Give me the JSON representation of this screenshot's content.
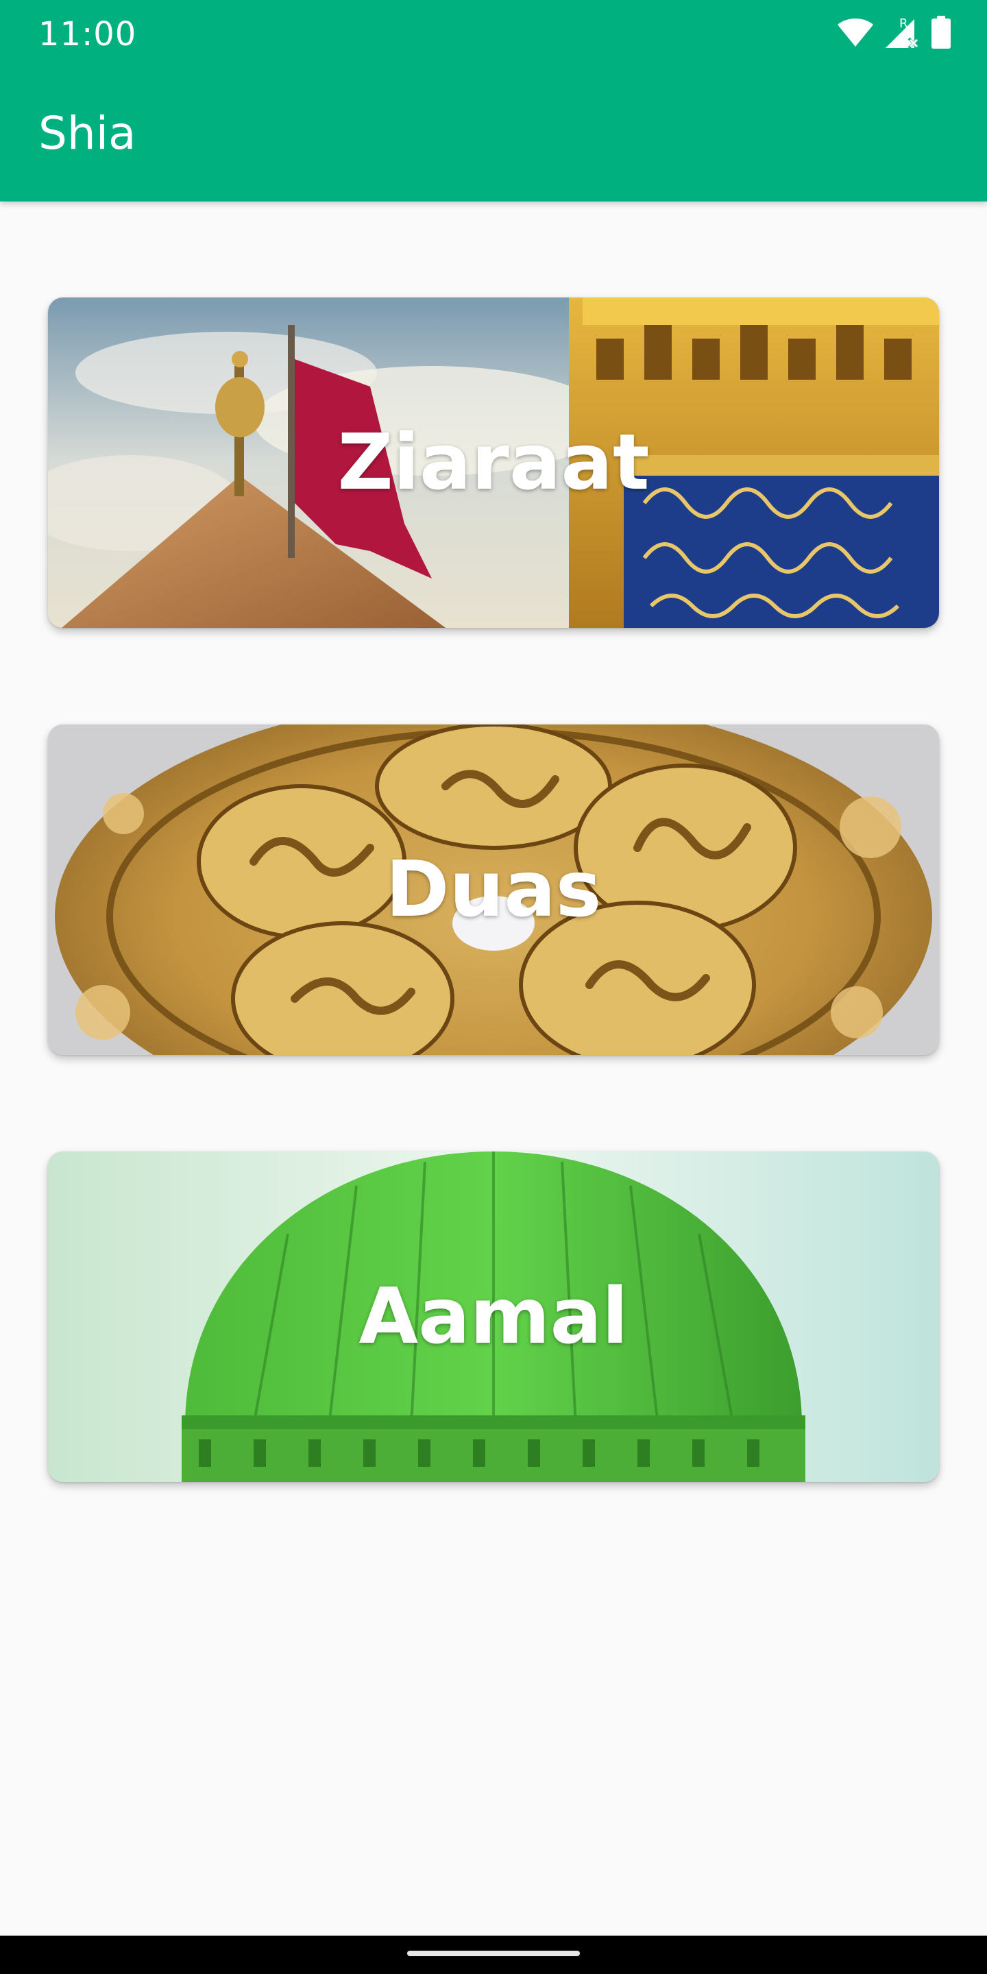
{
  "status_bar": {
    "time": "11:00",
    "icons": [
      "wifi-icon",
      "signal-roaming-icon",
      "battery-icon"
    ]
  },
  "app_bar": {
    "title": "Shia"
  },
  "cards": [
    {
      "label": "Ziaraat",
      "icon": "shrine-image"
    },
    {
      "label": "Duas",
      "icon": "calligraphy-image"
    },
    {
      "label": "Aamal",
      "icon": "green-dome-image"
    }
  ],
  "colors": {
    "primary": "#00b17f",
    "background": "#fafafa",
    "card_text": "#ffffff"
  }
}
